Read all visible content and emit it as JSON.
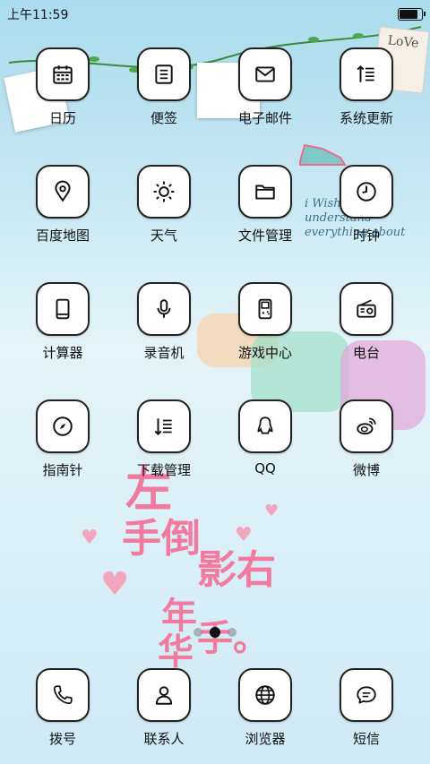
{
  "status_bar": {
    "time": "上午11:59",
    "battery_level_percent": 90
  },
  "apps": [
    {
      "label": "日历",
      "icon": "calendar-icon"
    },
    {
      "label": "便签",
      "icon": "note-icon"
    },
    {
      "label": "电子邮件",
      "icon": "mail-icon"
    },
    {
      "label": "系统更新",
      "icon": "system-update-icon"
    },
    {
      "label": "百度地图",
      "icon": "map-pin-icon"
    },
    {
      "label": "天气",
      "icon": "sun-icon"
    },
    {
      "label": "文件管理",
      "icon": "folder-icon"
    },
    {
      "label": "时钟",
      "icon": "clock-icon"
    },
    {
      "label": "计算器",
      "icon": "phone-device-icon"
    },
    {
      "label": "录音机",
      "icon": "microphone-icon"
    },
    {
      "label": "游戏中心",
      "icon": "gameboy-icon"
    },
    {
      "label": "电台",
      "icon": "radio-icon"
    },
    {
      "label": "指南针",
      "icon": "compass-icon"
    },
    {
      "label": "下载管理",
      "icon": "download-list-icon"
    },
    {
      "label": "QQ",
      "icon": "qq-penguin-icon"
    },
    {
      "label": "微博",
      "icon": "weibo-icon"
    }
  ],
  "dock": [
    {
      "label": "拨号",
      "icon": "phone-icon"
    },
    {
      "label": "联系人",
      "icon": "contact-icon"
    },
    {
      "label": "浏览器",
      "icon": "globe-icon"
    },
    {
      "label": "短信",
      "icon": "message-icon"
    }
  ],
  "pager": {
    "pages": 3,
    "current": 2
  },
  "wallpaper": {
    "love_tag": "LoVe",
    "script_text": "i Wish you to understand everything about",
    "title_text": [
      "左",
      "手倒",
      "影右",
      "年",
      "华",
      "手。"
    ],
    "accent_color": "#f27a9e"
  }
}
